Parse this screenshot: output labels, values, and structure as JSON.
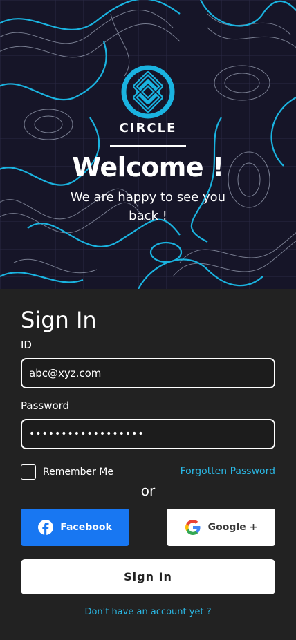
{
  "hero": {
    "brand": "CIRCLE",
    "welcome": "Welcome !",
    "tagline": "We are happy to see you back !",
    "logo_icon": "celtic-knot-icon"
  },
  "form": {
    "title": "Sign In",
    "id_label": "ID",
    "id_value": "abc@xyz.com",
    "password_label": "Password",
    "password_value": "••••••••••••••••••",
    "remember_label": "Remember Me",
    "remember_checked": false,
    "forgot_label": "Forgotten Password",
    "divider_text": "or",
    "facebook_label": "Facebook",
    "google_label": "Google +",
    "signin_label": "Sign In",
    "register_label": "Don't have an account yet ?"
  },
  "colors": {
    "accent": "#2bb7e3",
    "hero_bg": "#161528",
    "panel_bg": "#222222",
    "facebook": "#1877f2"
  }
}
